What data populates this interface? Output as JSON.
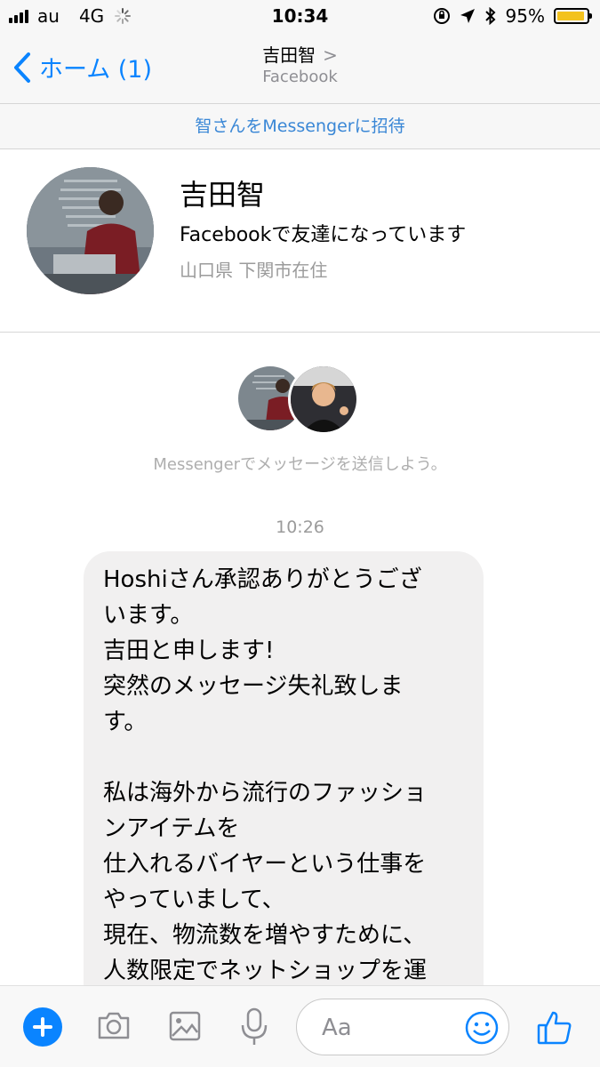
{
  "status_bar": {
    "carrier": "au",
    "network": "4G",
    "time": "10:34",
    "battery": "95%",
    "battery_level": 0.95
  },
  "nav": {
    "back_label": "ホーム (1)",
    "title": "吉田智",
    "subtitle": "Facebook"
  },
  "invite_text": "智さんをMessengerに招待",
  "profile": {
    "name": "吉田智",
    "friends_text": "Facebookで友達になっています",
    "location": "山口県 下関市在住"
  },
  "conversation_start_text": "Messengerでメッセージを送信しよう。",
  "timestamp": "10:26",
  "message": "Hoshiさん承認ありがとうござ\nいます。\n吉田と申します!\n突然のメッセージ失礼致しま\nす。\n\n私は海外から流行のファッショ\nンアイテムを\n仕入れるバイヤーという仕事を\nやっていまして、\n現在、物流数を増やすために、\n人数限定でネットショップを運",
  "composer": {
    "placeholder": "Aa"
  },
  "colors": {
    "accent": "#0a84ff",
    "invite_link": "#3a87d6",
    "bubble": "#f1f0f0",
    "battery_fill": "#f3c21e"
  },
  "icons": [
    "plus-icon",
    "camera-icon",
    "image-icon",
    "microphone-icon",
    "emoji-icon",
    "thumbs-up-icon",
    "chevron-left-icon",
    "chevron-right-icon",
    "location-arrow-icon",
    "bluetooth-icon",
    "rotation-lock-icon"
  ]
}
